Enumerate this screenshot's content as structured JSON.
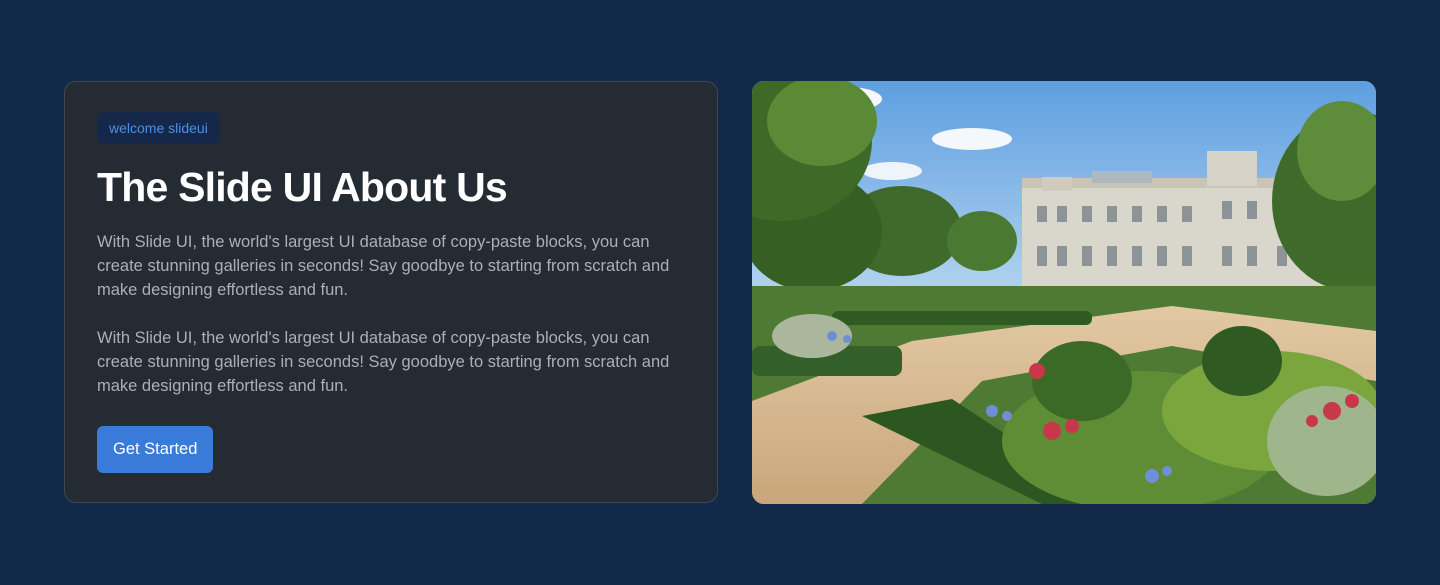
{
  "hero": {
    "badge": "welcome slideui",
    "title": "The Slide UI About Us",
    "paragraphs": [
      "With Slide UI, the world's largest UI database of copy-paste blocks, you can create stunning galleries in seconds! Say goodbye to starting from scratch and make designing effortless and fun.",
      "With Slide UI, the world's largest UI database of copy-paste blocks, you can create stunning galleries in seconds! Say goodbye to starting from scratch and make designing effortless and fun."
    ],
    "cta_label": "Get Started"
  },
  "colors": {
    "page_background": "#13294a",
    "card_background": "#242b33",
    "badge_text": "#4a8fe6",
    "button_background": "#3a7bd9"
  }
}
